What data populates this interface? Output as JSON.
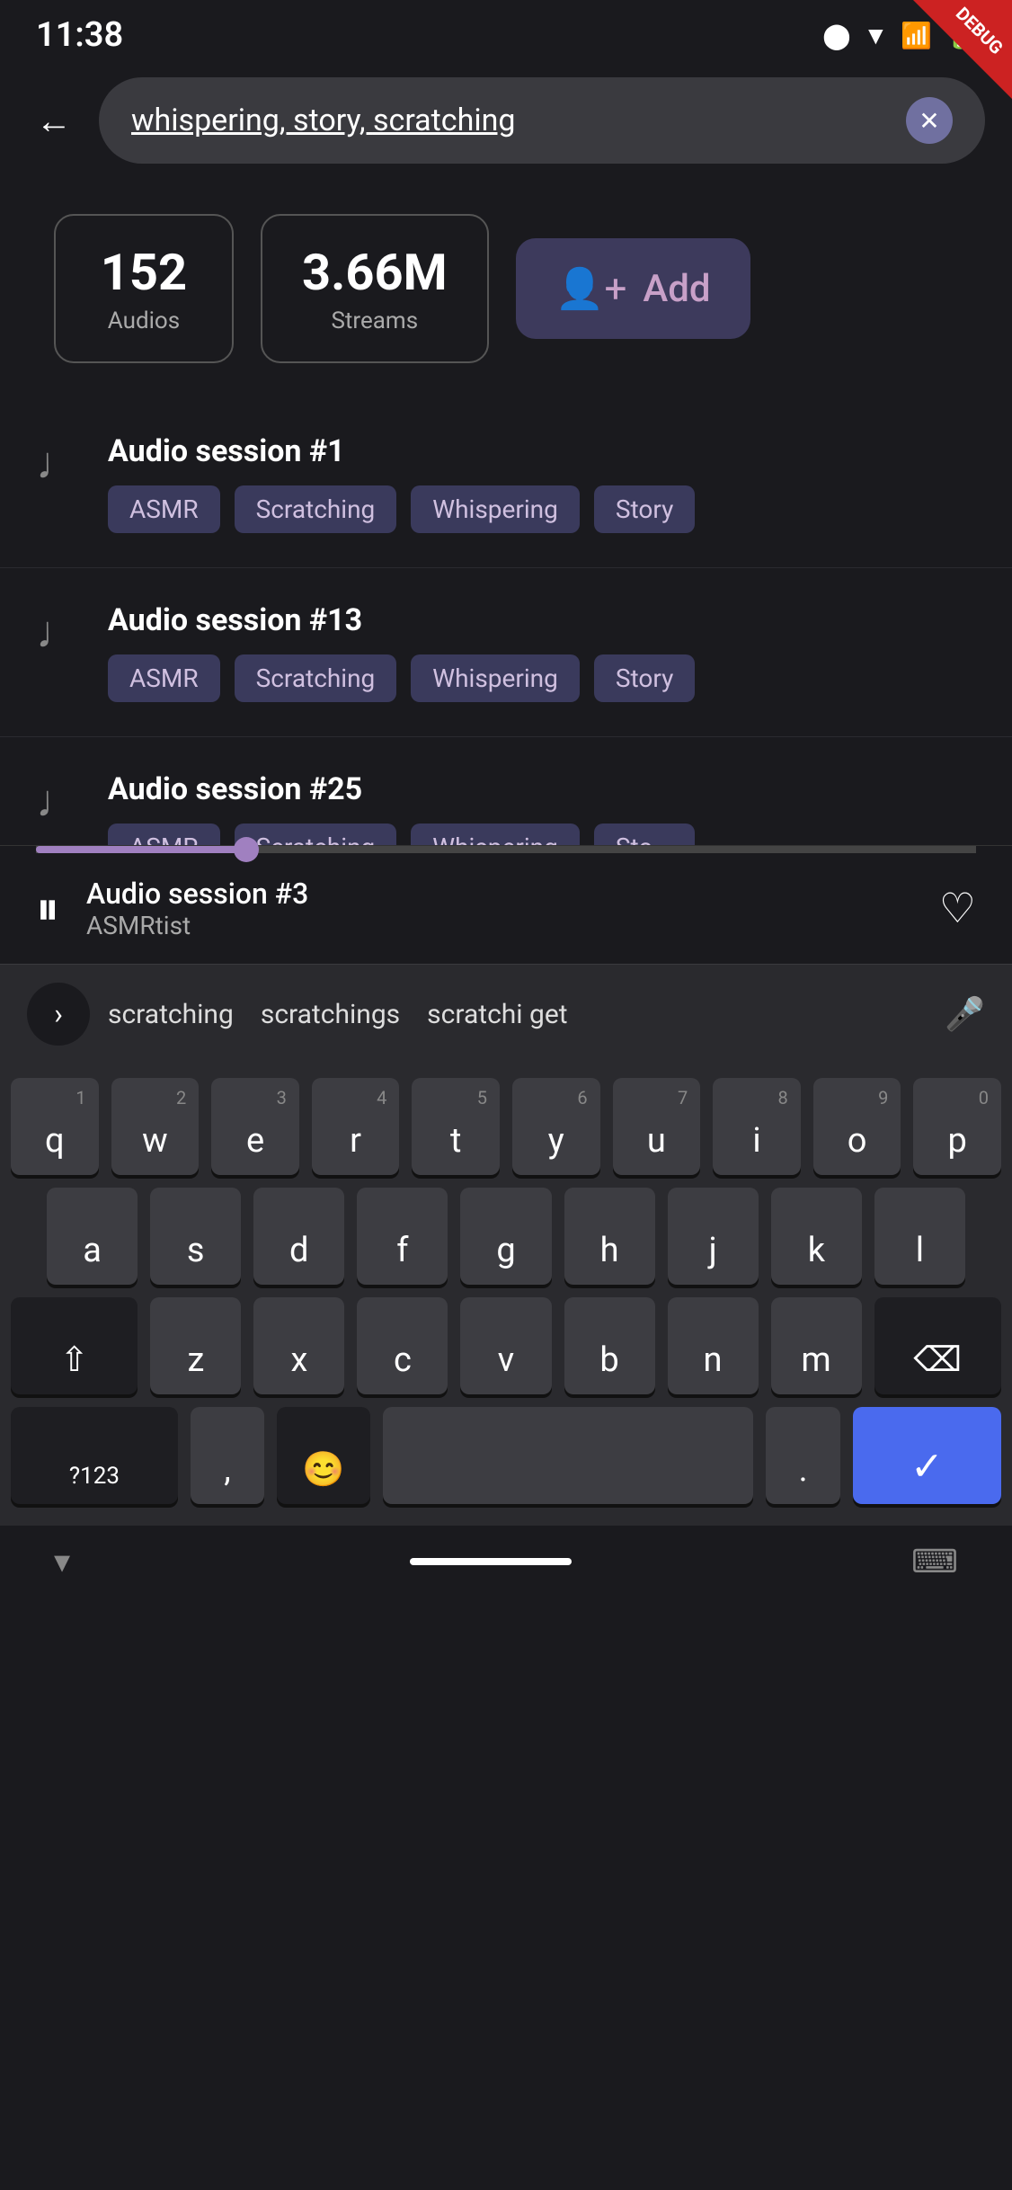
{
  "statusBar": {
    "time": "11:38",
    "icons": [
      "circle-icon",
      "wifi-icon",
      "signal-icon",
      "battery-icon"
    ]
  },
  "debug": {
    "label": "DEBUG"
  },
  "searchBar": {
    "backLabel": "←",
    "searchText": "whispering, story, ",
    "searchHighlight": "scratching",
    "clearIcon": "×"
  },
  "stats": {
    "audios": {
      "number": "152",
      "label": "Audios"
    },
    "streams": {
      "number": "3.66M",
      "label": "Streams"
    },
    "addButton": {
      "icon": "+👤",
      "label": "Add"
    }
  },
  "sessions": [
    {
      "id": "session-1",
      "title": "Audio session #1",
      "tags": [
        "ASMR",
        "Scratching",
        "Whispering",
        "Story"
      ]
    },
    {
      "id": "session-2",
      "title": "Audio session #13",
      "tags": [
        "ASMR",
        "Scratching",
        "Whispering",
        "Story"
      ]
    },
    {
      "id": "session-3",
      "title": "Audio session #25",
      "tags": [
        "ASMR",
        "Scratching",
        "Whispering",
        "Sto..."
      ]
    }
  ],
  "nowPlaying": {
    "title": "Audio session #3",
    "artist": "ASMRtist",
    "progress": 22
  },
  "autocomplete": {
    "suggestions": [
      "scratching",
      "scratchings",
      "scratchi get"
    ],
    "arrowIcon": "›",
    "micIcon": "🎤"
  },
  "keyboard": {
    "row1": [
      {
        "letter": "q",
        "num": "1"
      },
      {
        "letter": "w",
        "num": "2"
      },
      {
        "letter": "e",
        "num": "3"
      },
      {
        "letter": "r",
        "num": "4"
      },
      {
        "letter": "t",
        "num": "5"
      },
      {
        "letter": "y",
        "num": "6"
      },
      {
        "letter": "u",
        "num": "7"
      },
      {
        "letter": "i",
        "num": "8"
      },
      {
        "letter": "o",
        "num": "9"
      },
      {
        "letter": "p",
        "num": "0"
      }
    ],
    "row2": [
      {
        "letter": "a"
      },
      {
        "letter": "s"
      },
      {
        "letter": "d"
      },
      {
        "letter": "f"
      },
      {
        "letter": "g"
      },
      {
        "letter": "h"
      },
      {
        "letter": "j"
      },
      {
        "letter": "k"
      },
      {
        "letter": "l"
      }
    ],
    "row3": [
      {
        "letter": "⇧",
        "special": true
      },
      {
        "letter": "z"
      },
      {
        "letter": "x"
      },
      {
        "letter": "c"
      },
      {
        "letter": "v"
      },
      {
        "letter": "b"
      },
      {
        "letter": "n"
      },
      {
        "letter": "m"
      },
      {
        "letter": "⌫",
        "special": true
      }
    ],
    "row4": [
      {
        "letter": "?123",
        "special": true
      },
      {
        "letter": ","
      },
      {
        "letter": "😊",
        "emoji": true
      },
      {
        "letter": "",
        "space": true
      },
      {
        "letter": ".",
        "dot": true
      },
      {
        "letter": "✓",
        "action": true
      }
    ]
  },
  "bottomNav": {
    "downIcon": "▾",
    "keyboardIcon": "⌨"
  }
}
